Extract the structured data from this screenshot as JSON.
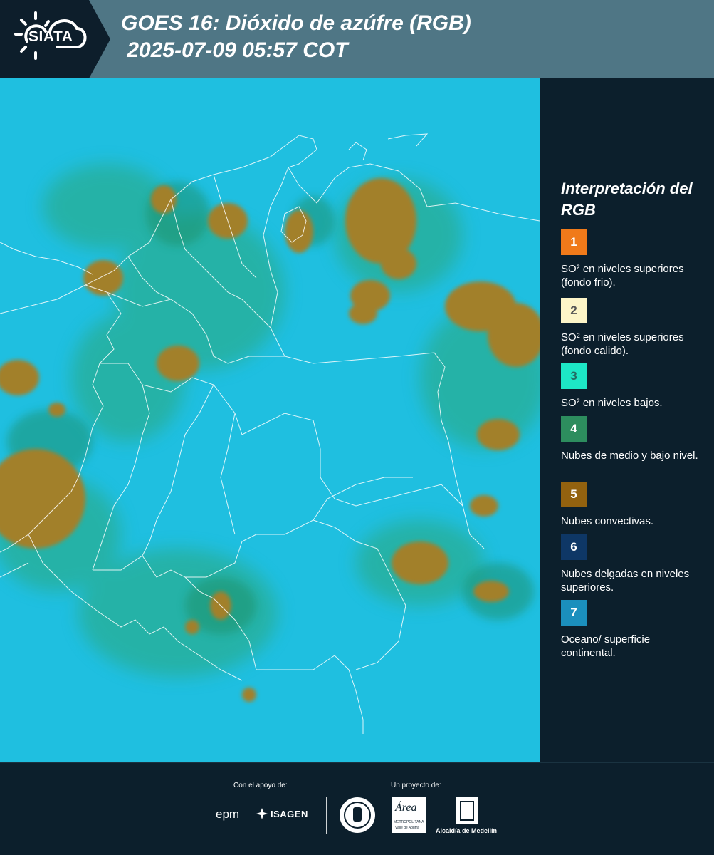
{
  "header": {
    "logo_text": "SIATA",
    "title_line1": "GOES 16: Dióxido de azúfre (RGB)",
    "title_line2": " 2025-07-09 05:57 COT"
  },
  "legend": {
    "title": "Interpretación del RGB",
    "items": [
      {
        "number": "1",
        "color": "#f07a1a",
        "number_color": "#ffffff",
        "label": "SO² en niveles superiores (fondo frio)."
      },
      {
        "number": "2",
        "color": "#fdf5c8",
        "number_color": "#555555",
        "label": "SO² en niveles superiores (fondo calido)."
      },
      {
        "number": "3",
        "color": "#1de7c6",
        "number_color": "#236b63",
        "label": "SO² en niveles bajos."
      },
      {
        "number": "4",
        "color": "#2d8d5e",
        "number_color": "#ffffff",
        "label": "Nubes de medio y bajo nivel."
      },
      {
        "number": "5",
        "color": "#93620f",
        "number_color": "#ffffff",
        "label": "Nubes convectivas."
      },
      {
        "number": "6",
        "color": "#0e3766",
        "number_color": "#ffffff",
        "label": "Nubes delgadas en niveles superiores."
      },
      {
        "number": "7",
        "color": "#1b8fbd",
        "number_color": "#ffffff",
        "label": "Oceano/ superficie continental."
      }
    ]
  },
  "footer": {
    "support_label": "Con el apoyo de:",
    "project_label": "Un proyecto de:",
    "sponsors": [
      "epm",
      "ISAGEN"
    ],
    "partners": [
      "Área Metropolitana Valle de Aburrá",
      "Alcaldía de Medellín"
    ],
    "alcaldia_label": "Alcaldía de Medellín",
    "area_label": "Área",
    "area_sub": "METROPOLITANA",
    "area_sub2": "Valle de Aburrá"
  }
}
